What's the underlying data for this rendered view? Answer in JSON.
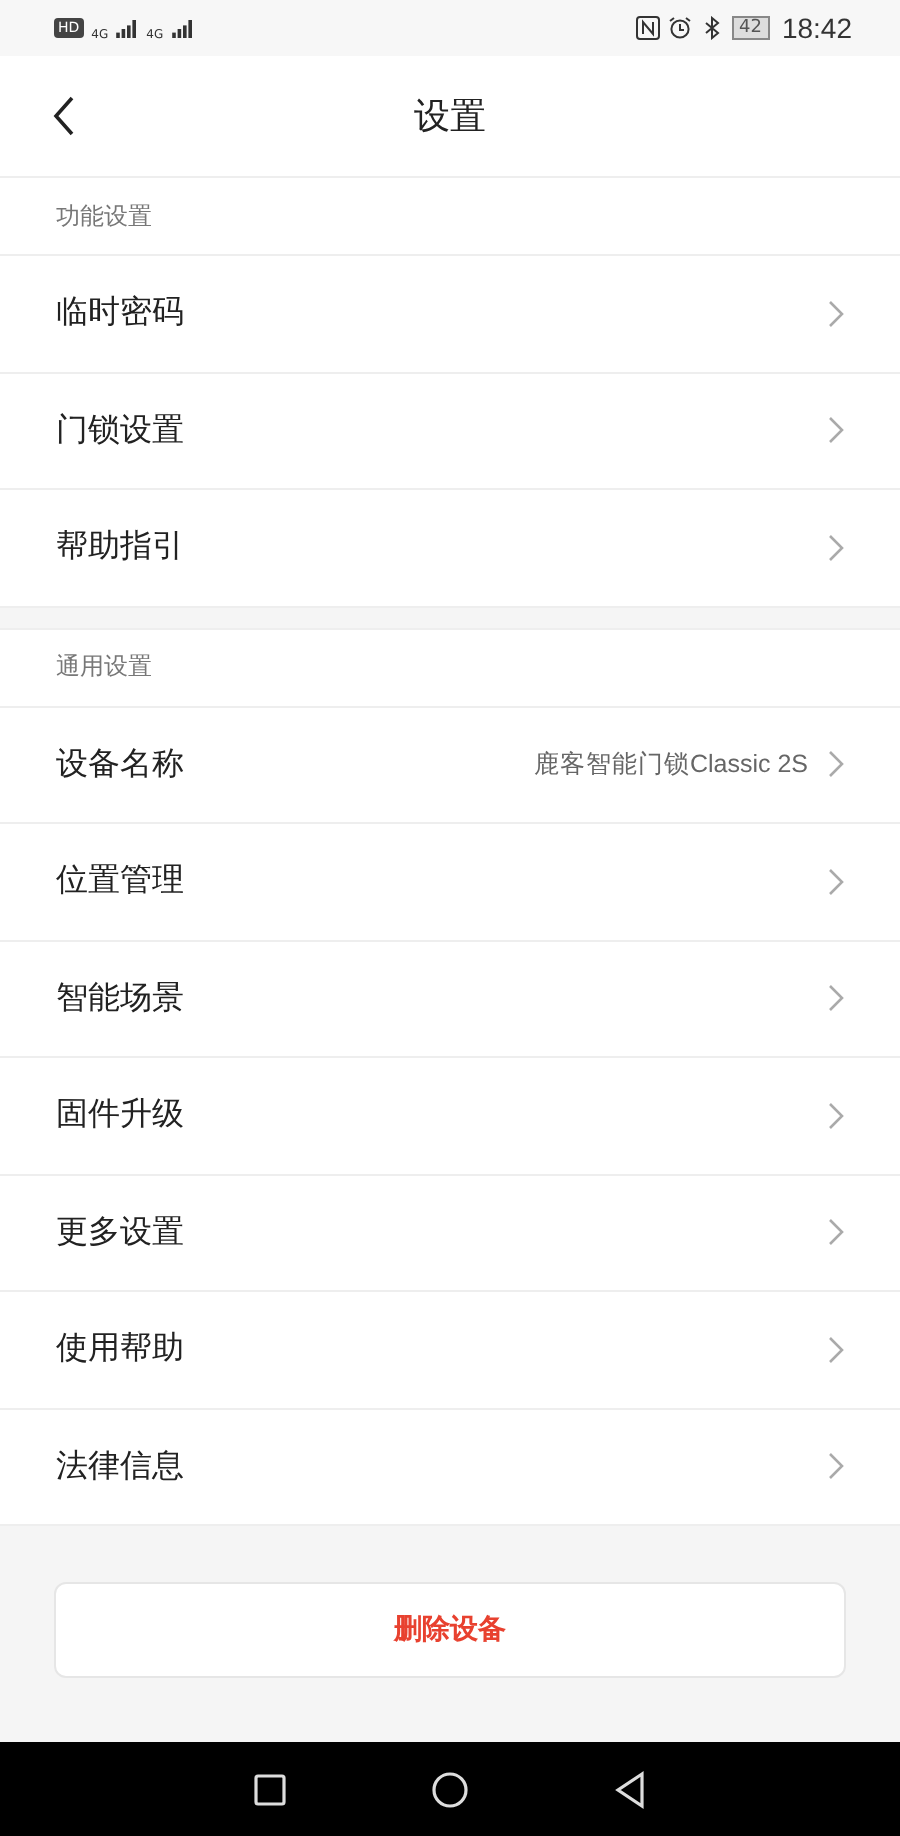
{
  "status_bar": {
    "hd": "HD",
    "networks": [
      "4G",
      "4G"
    ],
    "battery": "42",
    "time": "18:42"
  },
  "header": {
    "title": "设置"
  },
  "sections": [
    {
      "title": "功能设置",
      "items": [
        {
          "label": "临时密码"
        },
        {
          "label": "门锁设置"
        },
        {
          "label": "帮助指引"
        }
      ]
    },
    {
      "title": "通用设置",
      "items": [
        {
          "label": "设备名称",
          "value": "鹿客智能门锁Classic 2S"
        },
        {
          "label": "位置管理"
        },
        {
          "label": "智能场景"
        },
        {
          "label": "固件升级"
        },
        {
          "label": "更多设置"
        },
        {
          "label": "使用帮助"
        },
        {
          "label": "法律信息"
        }
      ]
    }
  ],
  "delete_button": "删除设备"
}
